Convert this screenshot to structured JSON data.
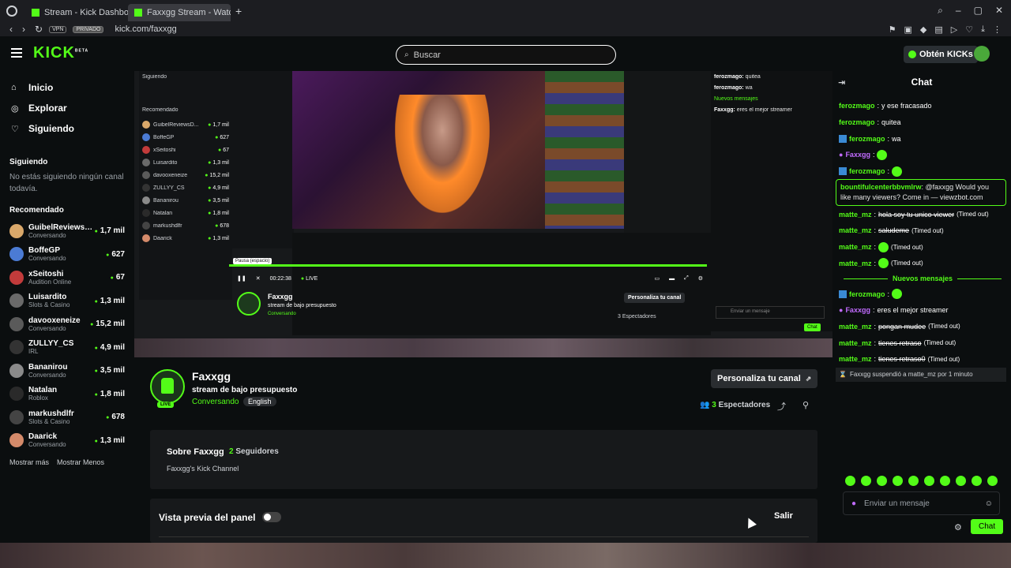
{
  "browser": {
    "tabs": [
      {
        "label": "Stream - Kick Dashboard"
      },
      {
        "label": "Faxxgg Stream - Watch Li"
      }
    ],
    "vpn": "VPN",
    "private": "PRIVADO",
    "url": "kick.com/faxxgg"
  },
  "header": {
    "logo": "KICK",
    "logo_badge": "BETA",
    "search_placeholder": "Buscar",
    "get_kicks": "Obtén KICKs"
  },
  "sidebar": {
    "nav": [
      {
        "label": "Inicio",
        "icon": "home-icon"
      },
      {
        "label": "Explorar",
        "icon": "compass-icon"
      },
      {
        "label": "Siguiendo",
        "icon": "heart-icon"
      }
    ],
    "following_title": "Siguiendo",
    "following_empty": "No estás siguiendo ningún canal todavía.",
    "recommended_title": "Recomendado",
    "recommended": [
      {
        "name": "GuibelReviewsD...",
        "category": "Conversando",
        "viewers": "1,7 mil",
        "color": "#d9a86a"
      },
      {
        "name": "BoffeGP",
        "category": "Conversando",
        "viewers": "627",
        "color": "#4b7bd4"
      },
      {
        "name": "xSeitoshi",
        "category": "Audition Online",
        "viewers": "67",
        "color": "#c23b3b"
      },
      {
        "name": "Luisardito",
        "category": "Slots & Casino",
        "viewers": "1,3 mil",
        "color": "#6a6a6a"
      },
      {
        "name": "davooxeneize",
        "category": "Conversando",
        "viewers": "15,2 mil",
        "color": "#5a5a5a"
      },
      {
        "name": "ZULLYY_CS",
        "category": "IRL",
        "viewers": "4,9 mil",
        "color": "#333333"
      },
      {
        "name": "Bananirou",
        "category": "Conversando",
        "viewers": "3,5 mil",
        "color": "#8a8a8a"
      },
      {
        "name": "Natalan",
        "category": "Roblox",
        "viewers": "1,8 mil",
        "color": "#2a2a2a"
      },
      {
        "name": "markushdlfr",
        "category": "Slots & Casino",
        "viewers": "678",
        "color": "#444444"
      },
      {
        "name": "Daarick",
        "category": "Conversando",
        "viewers": "1,3 mil",
        "color": "#d48a6a"
      }
    ],
    "show_more": "Mostrar más",
    "show_less": "Mostrar Menos"
  },
  "video": {
    "tooltip": "Pausa (espacio)",
    "time": "00:22:38",
    "live": "LIVE",
    "inner_name": "Faxxgg",
    "inner_title": "stream de bajo presupuesto",
    "inner_category": "Conversando",
    "inner_customize": "Personaliza tu canal",
    "inner_specs": "3 Espectadores",
    "inner_input": "Enviar un mensaje",
    "inner_chat": "Chat",
    "mini_following": "Siguiendo",
    "mini_recommended": "Recomendado"
  },
  "channel": {
    "name": "Faxxgg",
    "title": "stream de bajo presupuesto",
    "category": "Conversando",
    "language": "English",
    "live_badge": "LIVE",
    "customize": "Personaliza tu canal",
    "spectators_count": "3",
    "spectators_label": "Espectadores"
  },
  "about": {
    "title": "Sobre Faxxgg",
    "followers_count": "2",
    "followers_label": "Seguidores",
    "description": "Faxxgg's Kick Channel"
  },
  "panel": {
    "label": "Vista previa del panel",
    "exit": "Salir"
  },
  "chat": {
    "title": "Chat",
    "messages": [
      {
        "user": "ferozmago",
        "text": "y ese fracasado",
        "badge": false
      },
      {
        "user": "ferozmago",
        "text": "quitea",
        "badge": false
      },
      {
        "user": "ferozmago",
        "text": "wa",
        "badge": true
      },
      {
        "user": "Faxxgg",
        "text": "",
        "emote": true,
        "purple": true
      },
      {
        "user": "ferozmago",
        "text": "",
        "emote": true,
        "badge": true
      }
    ],
    "highlight": {
      "user": "bountifulcenterbbvmlrw",
      "text": "@faxxgg Would you like many viewers? Come in — viewzbot.com"
    },
    "timeouts": [
      {
        "user": "matte_mz",
        "text": "hola soy tu unico viewer",
        "note": "(Timed out)"
      },
      {
        "user": "matte_mz",
        "text": "saludeme",
        "note": "(Timed out)"
      },
      {
        "user": "matte_mz",
        "text": "",
        "note": "(Timed out)",
        "emote": true
      },
      {
        "user": "matte_mz",
        "text": "",
        "note": "(Timed out)",
        "emote": true
      }
    ],
    "new_messages": "Nuevos mensajes",
    "after": [
      {
        "user": "ferozmago",
        "text": "",
        "emote": true,
        "badge": true
      },
      {
        "user": "Faxxgg",
        "text": "eres el mejor streamer",
        "purple": true
      },
      {
        "user": "matte_mz",
        "text": "pongan mudee",
        "note": "(Timed out)"
      },
      {
        "user": "matte_mz",
        "text": "tienes retraso",
        "note": "(Timed out)"
      },
      {
        "user": "matte_mz",
        "text": "tienes retraso0",
        "note": "(Timed out)"
      }
    ],
    "system": "Faxxgg suspendió a matte_mz por 1 minuto",
    "input_placeholder": "Enviar un mensaje",
    "send": "Chat"
  }
}
